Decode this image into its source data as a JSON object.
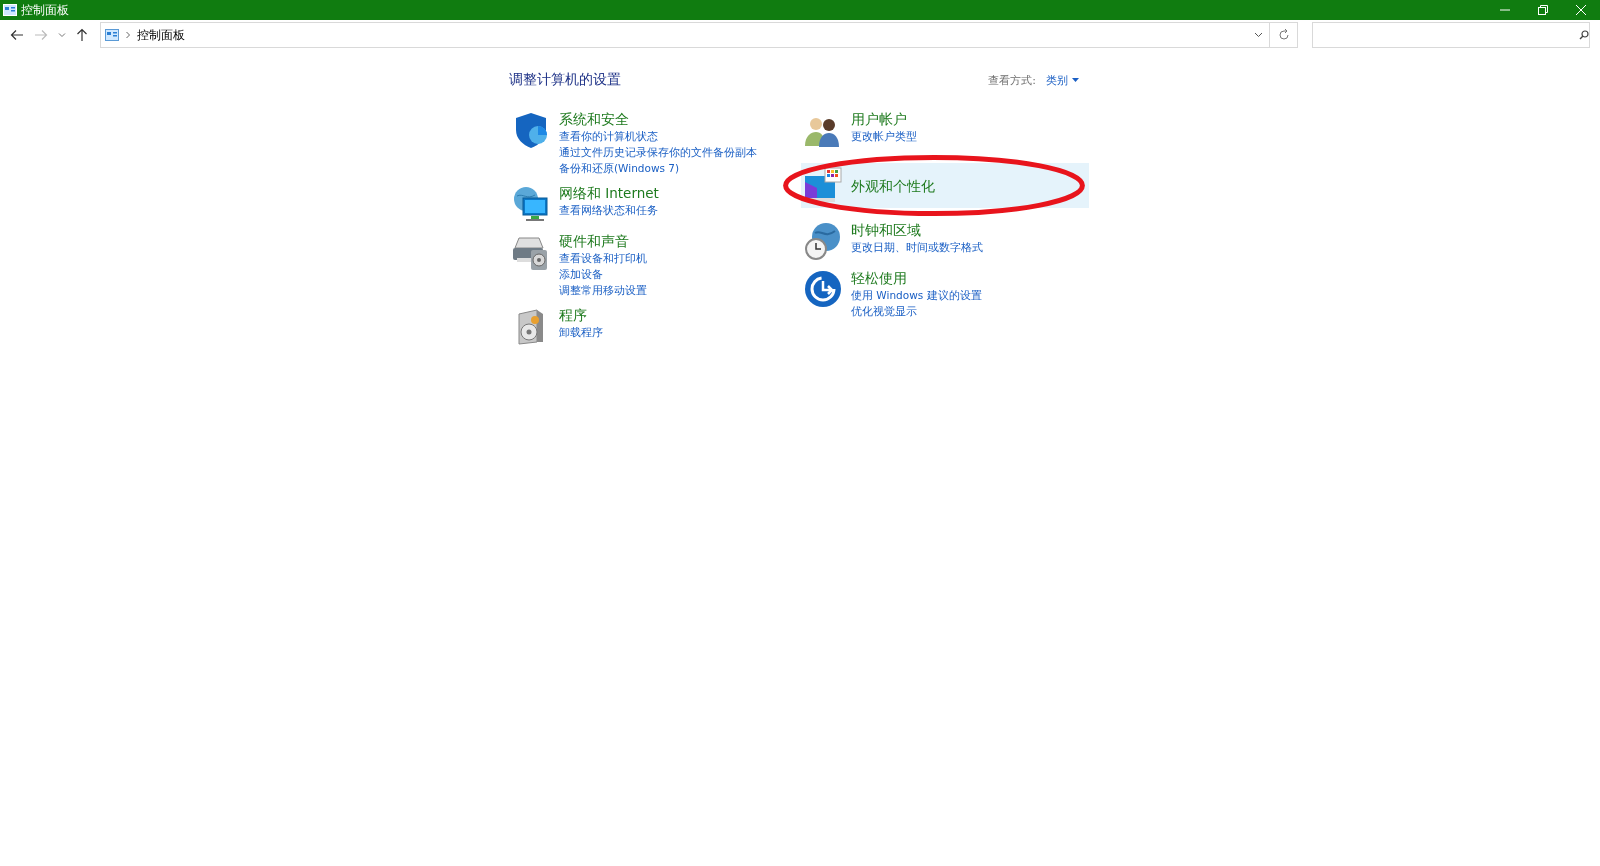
{
  "window": {
    "title": "控制面板"
  },
  "address_bar": {
    "path": [
      "控制面板"
    ]
  },
  "heading": "调整计算机的设置",
  "view_by": {
    "label": "查看方式:",
    "value": "类别"
  },
  "columns": [
    {
      "categories": [
        {
          "title": "系统和安全",
          "highlighted": false,
          "links": [
            "查看你的计算机状态",
            "通过文件历史记录保存你的文件备份副本",
            "备份和还原(Windows 7)"
          ]
        },
        {
          "title": "网络和 Internet",
          "highlighted": false,
          "links": [
            "查看网络状态和任务"
          ]
        },
        {
          "title": "硬件和声音",
          "highlighted": false,
          "links": [
            "查看设备和打印机",
            "添加设备",
            "调整常用移动设置"
          ]
        },
        {
          "title": "程序",
          "highlighted": false,
          "links": [
            "卸载程序"
          ]
        }
      ]
    },
    {
      "categories": [
        {
          "title": "用户帐户",
          "highlighted": false,
          "links": [
            "更改帐户类型"
          ]
        },
        {
          "title": "外观和个性化",
          "highlighted": true
        },
        {
          "title": "时钟和区域",
          "highlighted": false,
          "links": [
            "更改日期、时间或数字格式"
          ]
        },
        {
          "title": "轻松使用",
          "highlighted": false,
          "links": [
            "使用 Windows 建议的设置",
            "优化视觉显示"
          ]
        }
      ]
    }
  ],
  "annotation": {
    "kind": "ellipse"
  }
}
